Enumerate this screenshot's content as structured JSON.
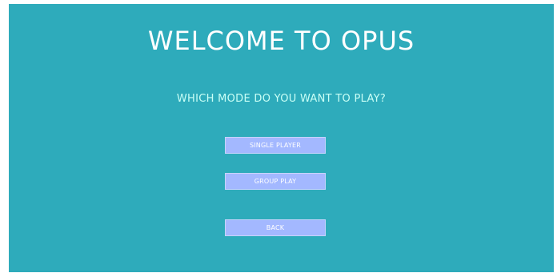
{
  "screen": {
    "title": "WELCOME TO OPUS",
    "subtitle": "WHICH MODE DO YOU WANT TO PLAY?"
  },
  "buttons": {
    "single_player": "SINGLE PLAYER",
    "group_play": "GROUP PLAY",
    "back": "BACK"
  },
  "colors": {
    "background": "#2eabbb",
    "title": "#ffffff",
    "subtitle": "#c9fff6",
    "button": "#a3b8ff",
    "button_text": "#ffffff"
  }
}
